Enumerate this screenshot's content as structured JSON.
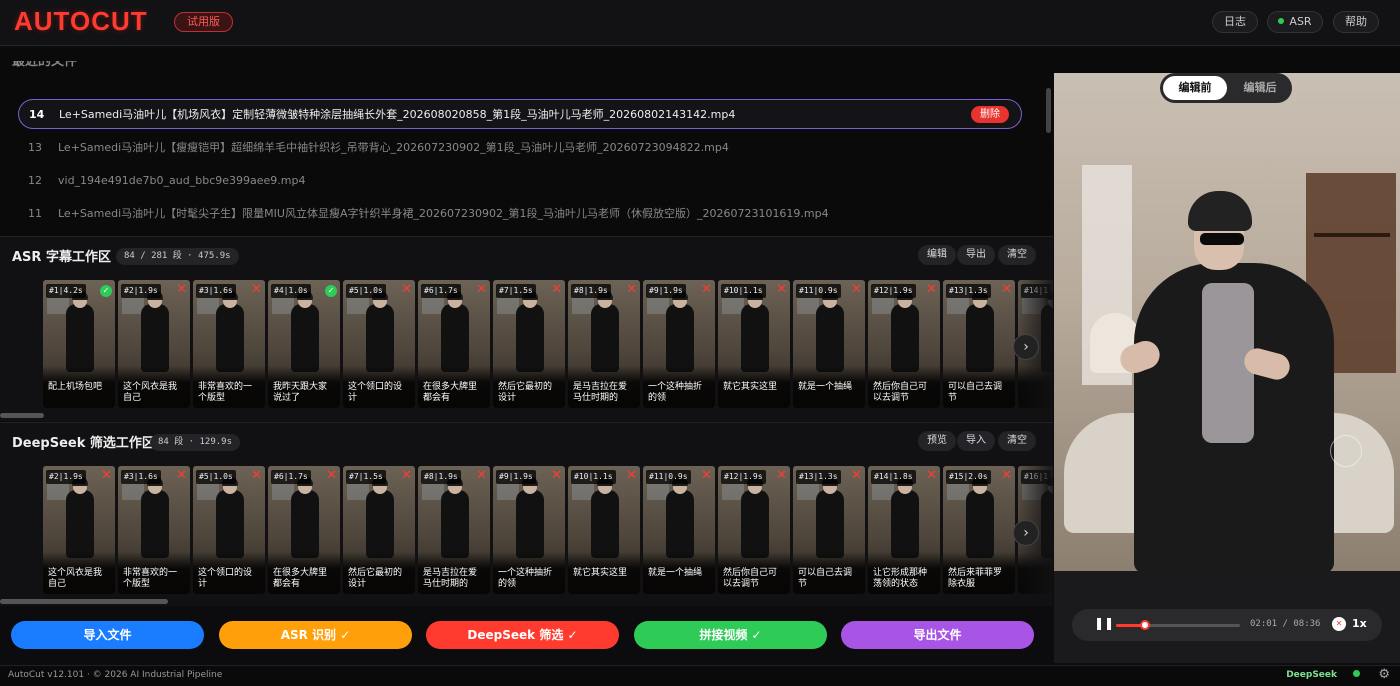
{
  "app": {
    "logo": "AUTOCUT",
    "trial_badge": "试用版"
  },
  "topbar": {
    "log": "日志",
    "asr": "ASR",
    "help": "帮助"
  },
  "file_list": {
    "header": "最近的文件",
    "files": [
      {
        "num": "14",
        "name": "Le+Samedi马油叶儿【机场风衣】定制轻薄微皱特种涂层抽绳长外套_202608020858_第1段_马油叶儿马老师_20260802143142.mp4",
        "selected": true,
        "delete_label": "删除"
      },
      {
        "num": "13",
        "name": "Le+Samedi马油叶儿【瘦瘦铠甲】超细绵羊毛中袖针织衫_吊带背心_202607230902_第1段_马油叶儿马老师_20260723094822.mp4"
      },
      {
        "num": "12",
        "name": "vid_194e491de7b0_aud_bbc9e399aee9.mp4"
      },
      {
        "num": "11",
        "name": "Le+Samedi马油叶儿【时髦尖子生】限量MIU风立体显瘦A字针织半身裙_202607230902_第1段_马油叶儿马老师（休假放空版）_20260723101619.mp4"
      }
    ]
  },
  "asr": {
    "title": "ASR 字幕工作区",
    "count": "84 / 281 段 · 475.9s",
    "buttons": {
      "edit": "编辑",
      "export": "导出",
      "clear": "清空"
    },
    "cards": [
      {
        "label": "#1|4.2s",
        "caption": "配上机场包吧",
        "ok": true
      },
      {
        "label": "#2|1.9s",
        "caption": "这个风衣是我自己",
        "ok": false
      },
      {
        "label": "#3|1.6s",
        "caption": "非常喜欢的一个版型",
        "ok": false
      },
      {
        "label": "#4|1.0s",
        "caption": "我昨天跟大家说过了",
        "ok": true
      },
      {
        "label": "#5|1.0s",
        "caption": "这个领口的设计",
        "ok": false
      },
      {
        "label": "#6|1.7s",
        "caption": "在很多大牌里都会有",
        "ok": false
      },
      {
        "label": "#7|1.5s",
        "caption": "然后它最初的设计",
        "ok": false
      },
      {
        "label": "#8|1.9s",
        "caption": "是马吉拉在爱马仕时期的",
        "ok": false
      },
      {
        "label": "#9|1.9s",
        "caption": "一个这种抽折的领",
        "ok": false
      },
      {
        "label": "#10|1.1s",
        "caption": "就它其实这里",
        "ok": false
      },
      {
        "label": "#11|0.9s",
        "caption": "就是一个抽绳",
        "ok": false
      },
      {
        "label": "#12|1.9s",
        "caption": "然后你自己可以去调节",
        "ok": false
      },
      {
        "label": "#13|1.3s",
        "caption": "可以自己去调节",
        "ok": false
      },
      {
        "label": "#14|1",
        "caption": "",
        "ok": false
      }
    ]
  },
  "deepseek": {
    "title": "DeepSeek 筛选工作区",
    "count": "84 段 · 129.9s",
    "buttons": {
      "preview": "预览",
      "import": "导入",
      "clear": "清空"
    },
    "cards": [
      {
        "label": "#2|1.9s",
        "caption": "这个风衣是我自己"
      },
      {
        "label": "#3|1.6s",
        "caption": "非常喜欢的一个版型"
      },
      {
        "label": "#5|1.0s",
        "caption": "这个领口的设计"
      },
      {
        "label": "#6|1.7s",
        "caption": "在很多大牌里都会有"
      },
      {
        "label": "#7|1.5s",
        "caption": "然后它最初的设计"
      },
      {
        "label": "#8|1.9s",
        "caption": "是马吉拉在爱马仕时期的"
      },
      {
        "label": "#9|1.9s",
        "caption": "一个这种抽折的领"
      },
      {
        "label": "#10|1.1s",
        "caption": "就它其实这里"
      },
      {
        "label": "#11|0.9s",
        "caption": "就是一个抽绳"
      },
      {
        "label": "#12|1.9s",
        "caption": "然后你自己可以去调节"
      },
      {
        "label": "#13|1.3s",
        "caption": "可以自己去调节"
      },
      {
        "label": "#14|1.8s",
        "caption": "让它形成那种荡领的状态"
      },
      {
        "label": "#15|2.0s",
        "caption": "然后来菲菲罗除衣服"
      },
      {
        "label": "#16|1",
        "caption": ""
      }
    ]
  },
  "actions": {
    "import": "导入文件",
    "asr": "ASR 识别 ✓",
    "deepseek": "DeepSeek 筛选 ✓",
    "concat": "拼接视频 ✓",
    "export": "导出文件"
  },
  "preview": {
    "seg_before": "编辑前",
    "seg_after": "编辑后",
    "time_current": "02:01",
    "time_total": "08:36",
    "progress": 0.236,
    "rate": "1x"
  },
  "status": {
    "version": "AutoCut v12.101 · © 2026 AI Industrial Pipeline",
    "model": "DeepSeek"
  },
  "colors": {
    "accent_red": "#ff3b30",
    "blue": "#1a7cff",
    "orange": "#ff9f0a",
    "red": "#ff3b30",
    "green": "#2ecc57",
    "purple": "#a855e6"
  }
}
